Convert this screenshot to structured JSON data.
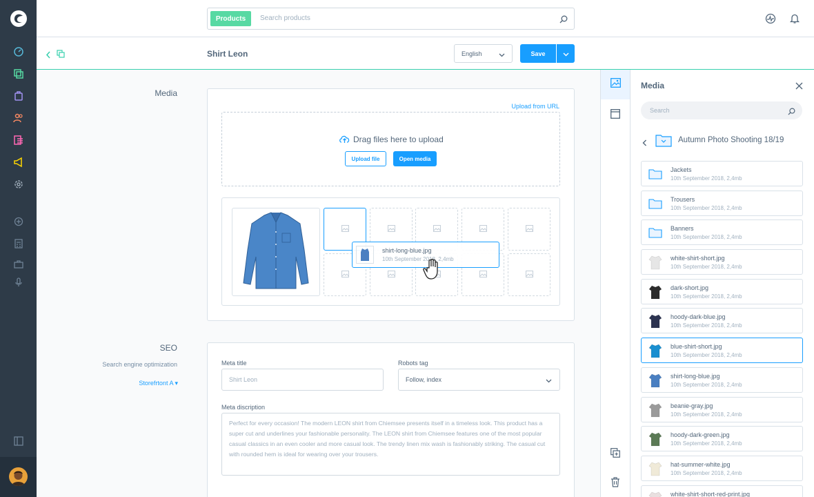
{
  "search": {
    "pill": "Products",
    "placeholder": "Search products"
  },
  "toolbar": {
    "title": "Shirt Leon",
    "language": "English",
    "save_label": "Save"
  },
  "media_section": {
    "label": "Media",
    "upload_from_url": "Upload from URL",
    "drag_text": "Drag files here to upload",
    "upload_file": "Upload file",
    "open_media": "Open media",
    "drag_preview": {
      "name": "shirt-long-blue.jpg",
      "meta": "10th September 2018, 2,4mb"
    }
  },
  "seo_section": {
    "label": "SEO",
    "sublabel": "Search engine optimization",
    "storefront": "Storefrtont A",
    "meta_title_label": "Meta title",
    "meta_title_placeholder": "Shirt Leon",
    "robots_label": "Robots tag",
    "robots_value": "Follow, index",
    "meta_desc_label": "Meta discription",
    "meta_desc_text": "Perfect for every occasion! The modern LEON shirt from Chiemsee presents itself in a timeless look. This product has a super cut and underlines your fashionable personality. The LEON shirt from Chiemsee features one of the most popular casual classics in an even cooler and more casual look. The trendy linen mix wash is fashionably striking. The casual cut with rounded hem is ideal for wearing over your trousers."
  },
  "media_panel": {
    "title": "Media",
    "search_placeholder": "Search",
    "folder": "Autumn Photo Shooting 18/19",
    "items": [
      {
        "name": "Jackets",
        "meta": "10th September 2018, 2,4mb",
        "kind": "folder"
      },
      {
        "name": "Trousers",
        "meta": "10th September 2018, 2,4mb",
        "kind": "folder"
      },
      {
        "name": "Banners",
        "meta": "10th September 2018, 2,4mb",
        "kind": "folder"
      },
      {
        "name": "white-shirt-short.jpg",
        "meta": "10th September 2018, 2,4mb",
        "kind": "image",
        "color": "#e6e6e6"
      },
      {
        "name": "dark-short.jpg",
        "meta": "10th September 2018, 2,4mb",
        "kind": "image",
        "color": "#2b2b2b"
      },
      {
        "name": "hoody-dark-blue.jpg",
        "meta": "10th September 2018, 2,4mb",
        "kind": "image",
        "color": "#2c3350"
      },
      {
        "name": "blue-shirt-short.jpg",
        "meta": "10th September 2018, 2,4mb",
        "kind": "image",
        "color": "#1a8fd0",
        "active": true
      },
      {
        "name": "shirt-long-blue.jpg",
        "meta": "10th September 2018, 2,4mb",
        "kind": "image",
        "color": "#4a7fc1"
      },
      {
        "name": "beanie-gray.jpg",
        "meta": "10th September 2018, 2,4mb",
        "kind": "image",
        "color": "#9a9a9a"
      },
      {
        "name": "hoody-dark-green.jpg",
        "meta": "10th September 2018, 2,4mb",
        "kind": "image",
        "color": "#5b7a55"
      },
      {
        "name": "hat-summer-white.jpg",
        "meta": "10th September 2018, 2,4mb",
        "kind": "image",
        "color": "#f0ead8"
      },
      {
        "name": "white-shirt-short-red-print.jpg",
        "meta": "",
        "kind": "image",
        "color": "#e9e0e0"
      }
    ]
  },
  "colors": {
    "accent": "#189eff",
    "brand_green": "#57d9a3",
    "rail": "#2e3b48"
  }
}
